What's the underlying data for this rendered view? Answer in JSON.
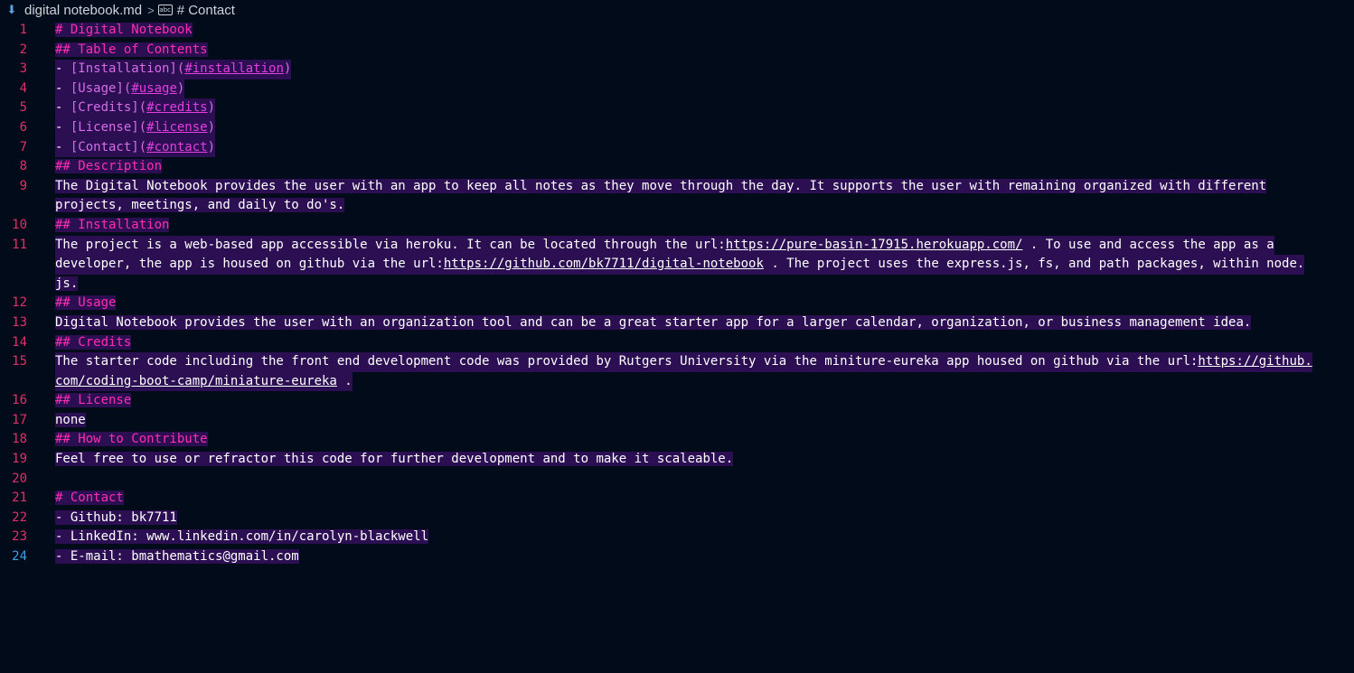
{
  "breadcrumb": {
    "file_icon": "markdown-file-icon",
    "file_name": "digital notebook.md",
    "separator": ">",
    "symbol_icon": "abc-string-symbol-icon",
    "symbol_name": "# Contact"
  },
  "colors": {
    "background": "#010b1a",
    "selection": "#2b0f52",
    "heading": "#ff2eae",
    "line_number": "#e0306a",
    "active_line_number": "#3d9fe8"
  },
  "editor": {
    "active_line": "24",
    "lines": {
      "l1": {
        "num": "1",
        "text": "# Digital Notebook"
      },
      "l2": {
        "num": "2",
        "text": "## Table of Contents"
      },
      "l3": {
        "num": "3",
        "dash": "- ",
        "lt": "[Installation]",
        "lo": "(",
        "url": "#installation",
        "lc": ")"
      },
      "l4": {
        "num": "4",
        "dash": "- ",
        "lt": "[Usage]",
        "lo": "(",
        "url": "#usage",
        "lc": ")"
      },
      "l5": {
        "num": "5",
        "dash": "- ",
        "lt": "[Credits]",
        "lo": "(",
        "url": "#credits",
        "lc": ")"
      },
      "l6": {
        "num": "6",
        "dash": "- ",
        "lt": "[License]",
        "lo": "(",
        "url": "#license",
        "lc": ")"
      },
      "l7": {
        "num": "7",
        "dash": "- ",
        "lt": "[Contact]",
        "lo": "(",
        "url": "#contact",
        "lc": ")"
      },
      "l8": {
        "num": "8",
        "text": "## Description"
      },
      "l9": {
        "num": "9",
        "text": "The Digital Notebook provides the user with an app to keep all notes as they move through the day. It supports the user with remaining organized with different"
      },
      "l9b": {
        "text": "projects, meetings, and daily to do's."
      },
      "l10": {
        "num": "10",
        "text": "## Installation"
      },
      "l11": {
        "num": "11",
        "a": "The project is a web-based app accessible via heroku. It can be located through the url:",
        "url": "https://pure-basin-17915.herokuapp.com/",
        "b": " . To use and access the app as a"
      },
      "l11b": {
        "a": "developer, the app is housed on github via the url:",
        "url": "https://github.com/bk7711/digital-notebook",
        "b": " . The project uses the express.js, fs, and path packages, within node."
      },
      "l11c": {
        "text": "js."
      },
      "l12": {
        "num": "12",
        "text": "## Usage"
      },
      "l13": {
        "num": "13",
        "text": "Digital Notebook provides the user with an organization tool and can be a great starter app for a larger calendar, organization, or business management idea."
      },
      "l14": {
        "num": "14",
        "text": "## Credits"
      },
      "l15": {
        "num": "15",
        "a": "The starter code including the front end development code was provided by Rutgers University via the miniture-eureka app housed on github via the url:",
        "url": "https://github."
      },
      "l15b": {
        "url": "com/coding-boot-camp/miniature-eureka",
        "b": " ."
      },
      "l16": {
        "num": "16",
        "text": "## License"
      },
      "l17": {
        "num": "17",
        "text": "none"
      },
      "l18": {
        "num": "18",
        "text": "## How to Contribute"
      },
      "l19": {
        "num": "19",
        "text": "Feel free to use or refractor this code for further development and to make it scaleable."
      },
      "l20": {
        "num": "20",
        "text": ""
      },
      "l21": {
        "num": "21",
        "text": "# Contact"
      },
      "l22": {
        "num": "22",
        "text": "- Github: bk7711"
      },
      "l23": {
        "num": "23",
        "text": "- LinkedIn: www.linkedin.com/in/carolyn-blackwell"
      },
      "l24": {
        "num": "24",
        "text": "- E-mail: bmathematics@gmail.com"
      }
    }
  }
}
